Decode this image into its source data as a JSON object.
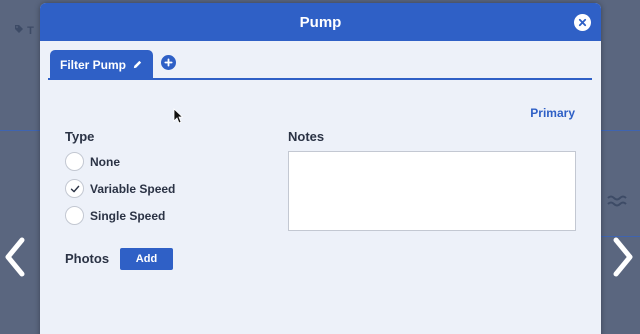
{
  "background": {
    "tag_text": "T"
  },
  "modal": {
    "title": "Pump",
    "tab_label": "Filter Pump",
    "primary_link": "Primary",
    "type_label": "Type",
    "type_options": [
      {
        "label": "None",
        "checked": false
      },
      {
        "label": "Variable Speed",
        "checked": true
      },
      {
        "label": "Single Speed",
        "checked": false
      }
    ],
    "notes_label": "Notes",
    "notes_value": "",
    "photos_label": "Photos",
    "add_button": "Add"
  },
  "colors": {
    "accent": "#2f60c6",
    "panel": "#edf1f9",
    "backdrop": "#5a667f"
  },
  "icons": [
    "tag-icon",
    "close-icon",
    "pencil-icon",
    "plus-circle-icon",
    "check-icon",
    "chevron-left-icon",
    "chevron-right-icon",
    "pointer-cursor-icon"
  ]
}
